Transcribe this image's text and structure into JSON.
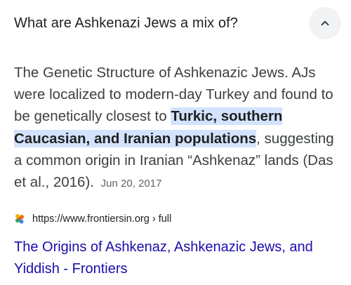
{
  "question": {
    "text": "What are Ashkenazi Jews a mix of?",
    "toggle_icon": "chevron-up-icon"
  },
  "answer": {
    "text_before": "The Genetic Structure of Ashkenazic Jews. AJs were localized to modern-day Turkey and found to be genetically closest to ",
    "highlight": "Turkic, southern Caucasian, and Iranian populations",
    "text_after": ", suggesting a common origin in Iranian “Ashkenaz” lands (Das et al., 2016).",
    "date": "Jun 20, 2017"
  },
  "source": {
    "favicon": "frontiers-favicon",
    "url": "https://www.frontiersin.org › full"
  },
  "result": {
    "title": "The Origins of Ashkenaz, Ashkenazic Jews, and Yiddish - Frontiers"
  },
  "colors": {
    "link": "#1a0dab",
    "highlight": "#d3e3fd",
    "button_bg": "#f1f3f4"
  }
}
